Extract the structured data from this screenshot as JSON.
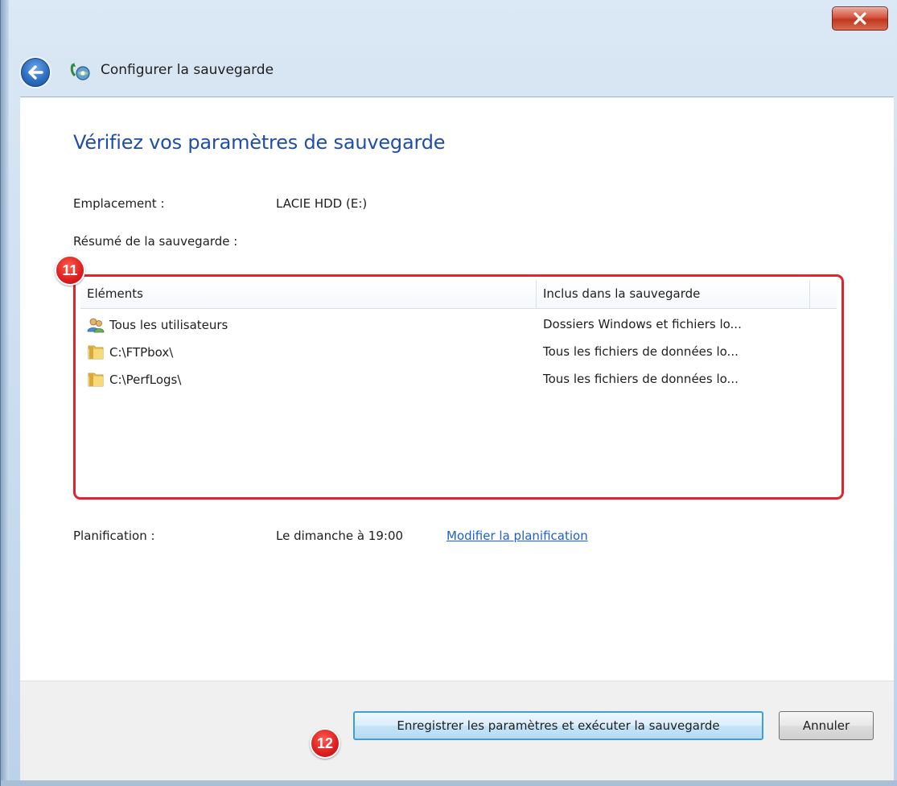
{
  "window": {
    "title": "Configurer la sauvegarde",
    "close_glyph": "X"
  },
  "page": {
    "heading": "Vérifiez vos paramètres de sauvegarde",
    "location_label": "Emplacement :",
    "location_value": "LACIE HDD (E:)",
    "summary_label": "Résumé de la sauvegarde :"
  },
  "table": {
    "columns": [
      "Eléments",
      "Inclus dans la sauvegarde"
    ],
    "rows": [
      {
        "icon": "users-icon",
        "item": "Tous les utilisateurs",
        "included": "Dossiers Windows et fichiers lo..."
      },
      {
        "icon": "folder-icon",
        "item": "C:\\FTPbox\\",
        "included": "Tous les fichiers de données lo..."
      },
      {
        "icon": "folder-icon",
        "item": "C:\\PerfLogs\\",
        "included": "Tous les fichiers de données lo..."
      }
    ]
  },
  "schedule": {
    "label": "Planification :",
    "value": "Le dimanche à 19:00",
    "link": "Modifier la planification"
  },
  "footer": {
    "save_run_label": "Enregistrer les paramètres et exécuter la sauvegarde",
    "cancel_label": "Annuler"
  },
  "annotations": {
    "list_marker": "11",
    "button_marker": "12"
  },
  "colors": {
    "heading": "#1f4ea8",
    "link": "#1a5fd6",
    "highlight": "#e0242f",
    "marker": "#dd1e1e"
  }
}
